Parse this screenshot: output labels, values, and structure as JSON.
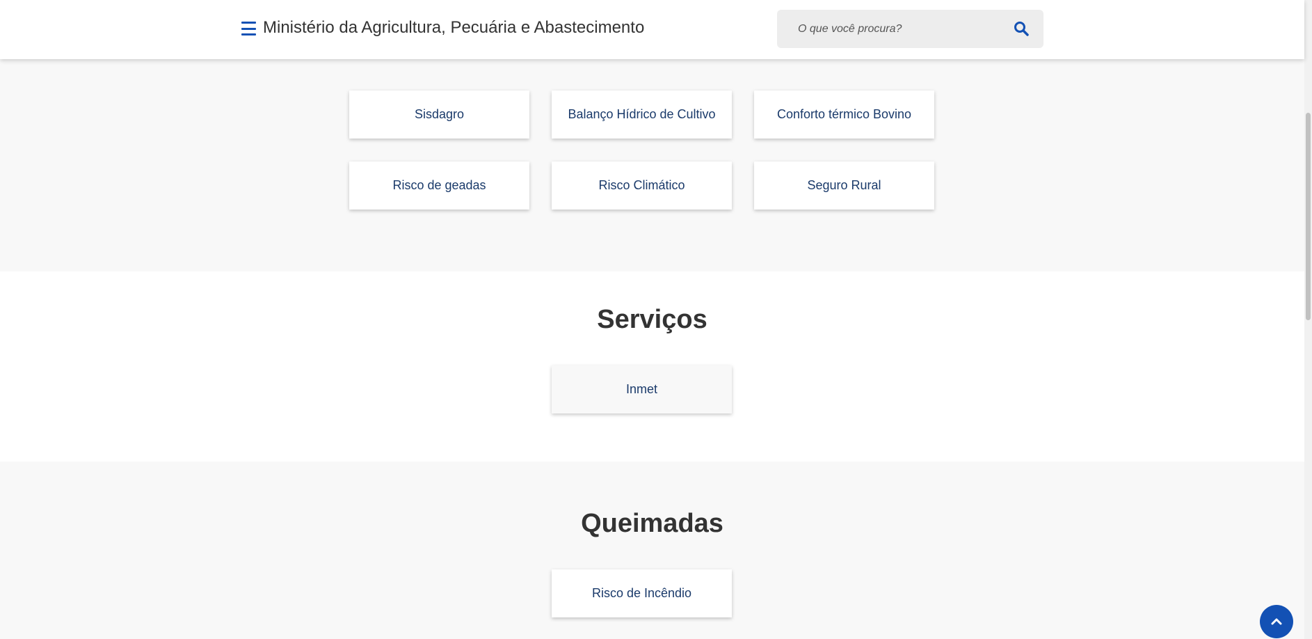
{
  "header": {
    "title": "Ministério da Agricultura, Pecuária e Abastecimento",
    "search_placeholder": "O que você procura?"
  },
  "top_section": {
    "partial_heading": "",
    "cards": [
      "Sisdagro",
      "Balanço Hídrico de Cultivo",
      "Conforto térmico Bovino",
      "Risco de geadas",
      "Risco Climático",
      "Seguro Rural"
    ]
  },
  "servicos": {
    "title": "Serviços",
    "cards": [
      "Inmet"
    ]
  },
  "queimadas": {
    "title": "Queimadas",
    "cards": [
      "Risco de Incêndio"
    ]
  },
  "colors": {
    "accent": "#1351b4",
    "link_text": "#1a3a6a",
    "heading": "#333333",
    "background_gray": "#f8f8f8"
  },
  "icons": {
    "menu": "hamburger-icon",
    "search": "search-icon",
    "back_to_top": "chevron-up-icon"
  }
}
